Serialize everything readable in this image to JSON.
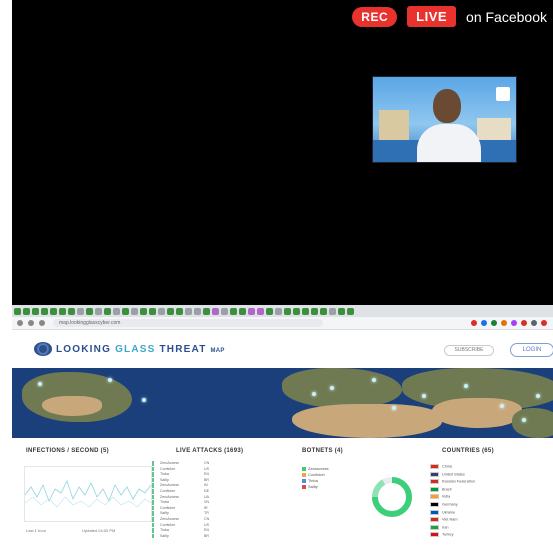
{
  "stream": {
    "rec_label": "REC",
    "live_label": "LIVE",
    "platform_label": "on Facebook",
    "colors": {
      "badge_red": "#e8322e",
      "background": "#000000"
    }
  },
  "browser": {
    "url": "map.lookingglasscyber.com",
    "tab_favicon_colors": [
      "#3c8f3c",
      "#3c8f3c",
      "#3c8f3c",
      "#3c8f3c",
      "#3c8f3c",
      "#3c8f3c",
      "#3c8f3c",
      "#9aa0a6",
      "#3c8f3c",
      "#9aa0a6",
      "#3c8f3c",
      "#9aa0a6",
      "#3c8f3c",
      "#9aa0a6",
      "#3c8f3c",
      "#3c8f3c",
      "#9aa0a6",
      "#3c8f3c",
      "#3c8f3c",
      "#9aa0a6",
      "#9aa0a6",
      "#3c8f3c",
      "#b266c9",
      "#9aa0a6",
      "#3c8f3c",
      "#3c8f3c",
      "#b266c9",
      "#b266c9",
      "#3c8f3c",
      "#9aa0a6",
      "#3c8f3c",
      "#3c8f3c",
      "#3c8f3c",
      "#3c8f3c",
      "#3c8f3c",
      "#9aa0a6",
      "#3c8f3c",
      "#3c8f3c"
    ],
    "extension_colors": [
      "#d93025",
      "#1a73e8",
      "#188038",
      "#e37400",
      "#a142f4",
      "#d93025",
      "#5f6368",
      "#d93025"
    ]
  },
  "site": {
    "logo_main": "LOOKING",
    "logo_accent": "GLASS",
    "logo_threat": "THREAT",
    "logo_small": "MAP",
    "header_link": "SUBSCRIBE",
    "header_button": "LOGIN"
  },
  "panels": {
    "infections_title": "INFECTIONS / SECOND (5)",
    "live_attacks_title": "LIVE ATTACKS (1693)",
    "botnets_title": "BOTNETS (4)",
    "countries_title": "COUNTRIES (65)",
    "chart_footer_left": "Last 1 hour",
    "chart_footer_right": "Updated 04:00 PM",
    "botnet_legend": [
      "Zeroaccess",
      "Conficker",
      "Tinba",
      "Sality"
    ],
    "countries": [
      "China",
      "United States",
      "Russian Federation",
      "Brazil",
      "India",
      "Germany",
      "Ukraine",
      "Viet Nam",
      "Iran",
      "Turkey"
    ],
    "attacks": [
      {
        "name": "ZeroAccess",
        "n": "CN"
      },
      {
        "name": "Conficker",
        "n": "US"
      },
      {
        "name": "Tinba",
        "n": "RU"
      },
      {
        "name": "Sality",
        "n": "BR"
      },
      {
        "name": "ZeroAccess",
        "n": "IN"
      },
      {
        "name": "Conficker",
        "n": "DE"
      },
      {
        "name": "ZeroAccess",
        "n": "UA"
      },
      {
        "name": "Tinba",
        "n": "VN"
      },
      {
        "name": "Conficker",
        "n": "IR"
      },
      {
        "name": "Sality",
        "n": "TR"
      },
      {
        "name": "ZeroAccess",
        "n": "CN"
      },
      {
        "name": "Conficker",
        "n": "US"
      },
      {
        "name": "Tinba",
        "n": "RU"
      },
      {
        "name": "Sality",
        "n": "BR"
      }
    ]
  }
}
